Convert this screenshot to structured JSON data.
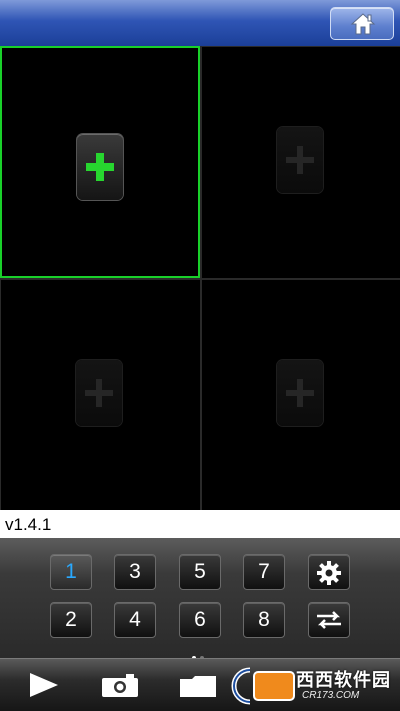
{
  "header": {
    "home_icon": "home-icon"
  },
  "grid": {
    "cells": [
      {
        "state": "selected",
        "icon": "add-icon"
      },
      {
        "state": "empty",
        "icon": "add-icon"
      },
      {
        "state": "empty",
        "icon": "add-icon"
      },
      {
        "state": "empty",
        "icon": "add-icon"
      }
    ]
  },
  "version": "v1.4.1",
  "keypad": {
    "row1": [
      "1",
      "3",
      "5",
      "7"
    ],
    "row2": [
      "2",
      "4",
      "6",
      "8"
    ],
    "active": "1",
    "settings_icon": "gear-icon",
    "switch_icon": "swap-arrows-icon",
    "page_dots": {
      "count": 2,
      "current": 1
    }
  },
  "toolbar": {
    "icons": [
      "play-icon",
      "camera-icon",
      "folder-icon"
    ]
  },
  "watermark": {
    "brand": "西西软件园",
    "url": "CR173.COM"
  },
  "colors": {
    "accent_green": "#19d12a",
    "active_key": "#29a9ff",
    "header_blue": "#2f55b5"
  }
}
